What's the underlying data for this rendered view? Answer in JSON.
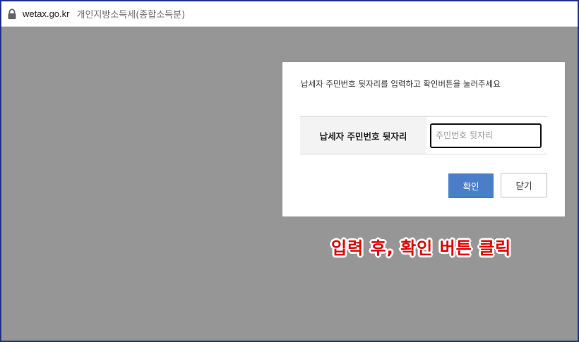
{
  "browser": {
    "url_host": "wetax.go.kr",
    "page_title": "개인지방소득세(종합소득분)",
    "lock_icon": "lock-icon"
  },
  "dialog": {
    "message": "납세자 주민번호 뒷자리를 입력하고 확인버튼을 눌러주세요",
    "field_label": "납세자 주민번호 뒷자리",
    "field_placeholder": "주민번호 뒷자리",
    "field_value": "",
    "confirm_label": "확인",
    "close_label": "닫기"
  },
  "annotation": {
    "text": "입력 후, 확인 버튼 클릭"
  },
  "colors": {
    "overlay": "#969696",
    "confirm_button": "#4a7ec8",
    "annotation": "#e00000",
    "frame_border": "#1f2f8a"
  }
}
